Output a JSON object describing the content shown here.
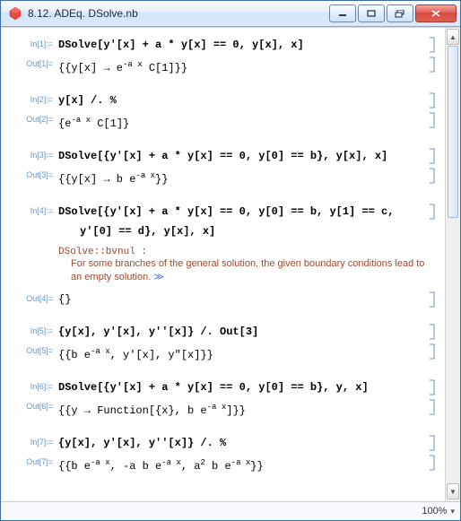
{
  "window": {
    "title": "8.12. ADEq. DSolve.nb"
  },
  "cells": {
    "in1_label": "In[1]:=",
    "in1": "DSolve[y'[x] + a * y[x] == 0, y[x], x]",
    "out1_label": "Out[1]=",
    "out1": "{{y[x] → e⁻ᵃˣ C[1]}}",
    "in2_label": "In[2]:=",
    "in2": "y[x] /. %",
    "out2_label": "Out[2]=",
    "out2": "{e⁻ᵃˣ C[1]}",
    "in3_label": "In[3]:=",
    "in3": "DSolve[{y'[x] + a * y[x] == 0, y[0] == b}, y[x], x]",
    "out3_label": "Out[3]=",
    "out3": "{{y[x] → b e⁻ᵃˣ}}",
    "in4_label": "In[4]:=",
    "in4a": "DSolve[{y'[x] + a * y[x] == 0, y[0] == b, y[1] == c,",
    "in4b": "y'[0] == d}, y[x], x]",
    "msg_head": "DSolve::bvnul :",
    "msg_body": "For some branches of the general solution, the given boundary conditions lead to an empty solution.",
    "msg_more": "≫",
    "out4_label": "Out[4]=",
    "out4": "{}",
    "in5_label": "In[5]:=",
    "in5": "{y[x], y'[x], y''[x]} /. Out[3]",
    "out5_label": "Out[5]=",
    "out5": "{{b e⁻ᵃˣ, y′[x], y″[x]}}",
    "in6_label": "In[6]:=",
    "in6": "DSolve[{y'[x] + a * y[x] == 0, y[0] == b}, y, x]",
    "out6_label": "Out[6]=",
    "out6": "{{y → Function[{x}, b e⁻ᵃˣ]}}",
    "in7_label": "In[7]:=",
    "in7": "{y[x], y'[x], y''[x]} /. %",
    "out7_label": "Out[7]=",
    "out7": "{{b e⁻ᵃˣ, -a b e⁻ᵃˣ, a² b e⁻ᵃˣ}}"
  },
  "status": {
    "zoom": "100%"
  }
}
